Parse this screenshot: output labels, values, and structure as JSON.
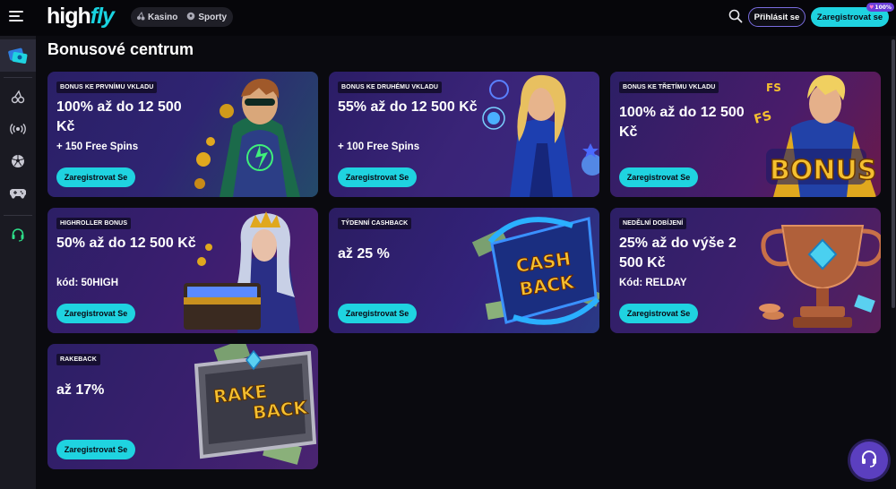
{
  "header": {
    "logo_high": "high",
    "logo_fly": "fly",
    "nav": [
      {
        "label": "Kasino",
        "icon": "cherries-icon"
      },
      {
        "label": "Sporty",
        "icon": "soccer-ball-icon"
      }
    ],
    "login_label": "Přihlásit se",
    "register_label": "Zaregistrovat se",
    "badge": "100%"
  },
  "sidebar": {
    "items": [
      "promo-tickets-icon",
      "cherries-icon",
      "live-broadcast-icon",
      "soccer-ball-icon",
      "gamepad-icon",
      "headset-icon"
    ]
  },
  "page": {
    "title": "Bonusové centrum"
  },
  "cards": [
    {
      "tag": "BONUS KE PRVNÍMU VKLADU",
      "headline": "100% až do 12 500 Kč",
      "sub": "+ 150 Free Spins",
      "cta": "Zaregistrovat Se",
      "art": "superhero-man"
    },
    {
      "tag": "BONUS KE DRUHÉMU VKLADU",
      "headline": "55% až do 12 500 Kč",
      "sub": "+ 100 Free Spins",
      "cta": "Zaregistrovat Se",
      "art": "superhero-woman"
    },
    {
      "tag": "BONUS KE TŘETÍMU VKLADU",
      "headline": "100% až do 12 500 Kč",
      "sub": "",
      "cta": "Zaregistrovat Se",
      "art": "bonus-hero"
    },
    {
      "tag": "HIGHROLLER BONUS",
      "headline": "50% až do 12 500 Kč",
      "sub": "kód: 50HIGH",
      "cta": "Zaregistrovat Se",
      "art": "queen-chest"
    },
    {
      "tag": "TÝDENNÍ CASHBACK",
      "headline": "až 25 %",
      "sub": "",
      "cta": "Zaregistrovat Se",
      "art": "cashback-emblem"
    },
    {
      "tag": "NEDĚLNÍ DOBÍJENÍ",
      "headline": "25% až do výše 2 500 Kč",
      "sub": "Kód: RELDAY",
      "cta": "Zaregistrovat Se",
      "art": "trophy"
    },
    {
      "tag": "RAKEBACK",
      "headline": "až 17%",
      "sub": "",
      "cta": "Zaregistrovat Se",
      "art": "rakeback-emblem"
    }
  ],
  "art_text": {
    "fs": "FS",
    "bonus": "BONUS",
    "cash": "CASH",
    "back": "BACK",
    "rake": "RAKE",
    "rakeback_back": "BACK"
  },
  "colors": {
    "accent": "#1fd3e0",
    "background": "#0a0a0f",
    "sidebar": "#1a1a22",
    "support": "#5b3fbf"
  }
}
